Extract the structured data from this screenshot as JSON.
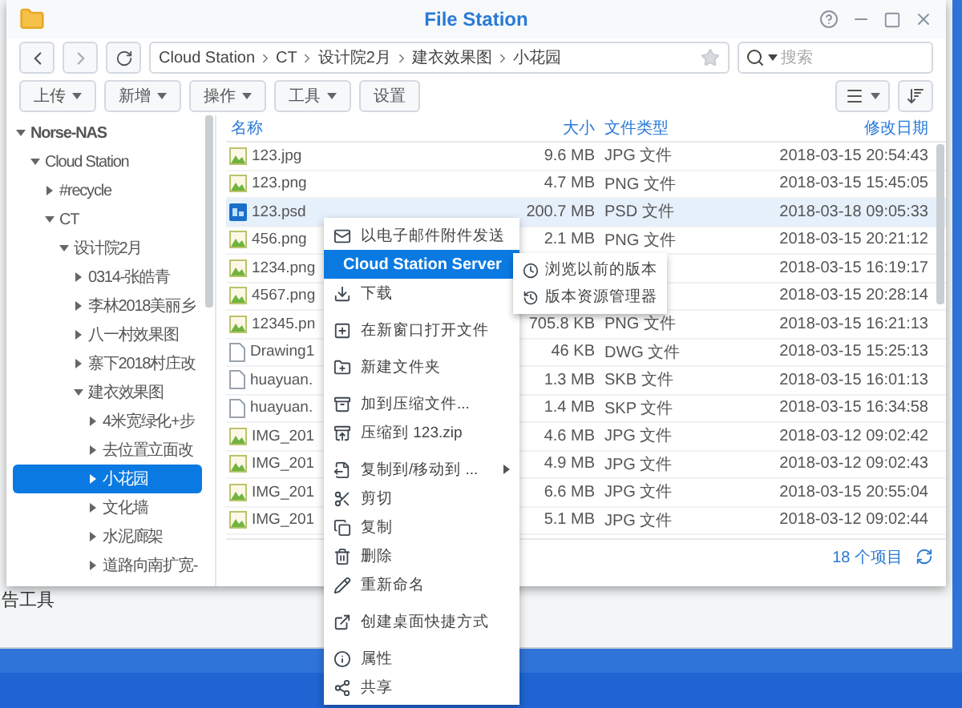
{
  "background_window": {
    "sidebar_text": "告工具"
  },
  "window": {
    "title": "File Station"
  },
  "path": {
    "segments": [
      "Cloud Station",
      "CT",
      "设计院2月",
      "建衣效果图",
      "小花园"
    ]
  },
  "search": {
    "placeholder": "搜索"
  },
  "toolbar": {
    "buttons": [
      {
        "label": "上传",
        "dropdown": true
      },
      {
        "label": "新增",
        "dropdown": true
      },
      {
        "label": "操作",
        "dropdown": true
      },
      {
        "label": "工具",
        "dropdown": true
      },
      {
        "label": "设置",
        "dropdown": false
      }
    ]
  },
  "tree": [
    {
      "label": "Norse-NAS",
      "expanded": true,
      "selected": false,
      "bold": true,
      "children": [
        {
          "label": "Cloud Station",
          "expanded": true,
          "selected": false,
          "children": [
            {
              "label": "#recycle",
              "expanded": false,
              "selected": false
            },
            {
              "label": "CT",
              "expanded": true,
              "selected": false,
              "children": [
                {
                  "label": "设计院2月",
                  "expanded": true,
                  "selected": false,
                  "children": [
                    {
                      "label": "0314-张皓青",
                      "expanded": false,
                      "selected": false
                    },
                    {
                      "label": "李林2018美丽乡",
                      "expanded": false,
                      "selected": false
                    },
                    {
                      "label": "八一村效果图",
                      "expanded": false,
                      "selected": false
                    },
                    {
                      "label": "寨下2018村庄改",
                      "expanded": false,
                      "selected": false
                    },
                    {
                      "label": "建衣效果图",
                      "expanded": true,
                      "selected": false,
                      "children": [
                        {
                          "label": "4米宽绿化+步",
                          "expanded": false,
                          "selected": false
                        },
                        {
                          "label": "去位置立面改",
                          "expanded": false,
                          "selected": false
                        },
                        {
                          "label": "小花园",
                          "expanded": false,
                          "selected": true
                        },
                        {
                          "label": "文化墙",
                          "expanded": false,
                          "selected": false
                        },
                        {
                          "label": "水泥廊架",
                          "expanded": false,
                          "selected": false
                        },
                        {
                          "label": "道路向南扩宽-",
                          "expanded": false,
                          "selected": false
                        }
                      ]
                    }
                  ]
                }
              ]
            }
          ]
        }
      ]
    }
  ],
  "table": {
    "columns": [
      "名称",
      "大小",
      "文件类型",
      "修改日期"
    ],
    "rows": [
      {
        "kind": "image",
        "name": "123.jpg",
        "size": "9.6 MB",
        "type": "JPG 文件",
        "modified": "2018-03-15 20:54:43",
        "selected": false
      },
      {
        "kind": "image",
        "name": "123.png",
        "size": "4.7 MB",
        "type": "PNG 文件",
        "modified": "2018-03-15 15:45:05",
        "selected": false
      },
      {
        "kind": "psd",
        "name": "123.psd",
        "size": "200.7 MB",
        "type": "PSD 文件",
        "modified": "2018-03-18 09:05:33",
        "selected": true
      },
      {
        "kind": "image",
        "name": "456.png",
        "size": "2.1 MB",
        "type": "PNG 文件",
        "modified": "2018-03-15 20:21:12",
        "selected": false
      },
      {
        "kind": "image",
        "name": "1234.png",
        "modified": "2018-03-15 16:19:17",
        "selected": false
      },
      {
        "kind": "image",
        "name": "4567.png",
        "modified": "2018-03-15 20:28:14",
        "selected": false
      },
      {
        "kind": "image",
        "name": "12345.pn",
        "size": "705.8 KB",
        "type": "PNG 文件",
        "modified": "2018-03-15 16:21:13",
        "selected": false
      },
      {
        "kind": "document",
        "name": "Drawing1",
        "size": "46 KB",
        "type": "DWG 文件",
        "modified": "2018-03-15 15:25:13",
        "selected": false
      },
      {
        "kind": "document",
        "name": "huayuan.",
        "size": "1.3 MB",
        "type": "SKB 文件",
        "modified": "2018-03-15 16:01:13",
        "selected": false
      },
      {
        "kind": "document",
        "name": "huayuan.",
        "size": "1.4 MB",
        "type": "SKP 文件",
        "modified": "2018-03-15 16:34:58",
        "selected": false
      },
      {
        "kind": "image",
        "name": "IMG_201",
        "size": "4.6 MB",
        "type": "JPG 文件",
        "modified": "2018-03-12 09:02:42",
        "selected": false
      },
      {
        "kind": "image",
        "name": "IMG_201",
        "size": "4.9 MB",
        "type": "JPG 文件",
        "modified": "2018-03-12 09:02:43",
        "selected": false
      },
      {
        "kind": "image",
        "name": "IMG_201",
        "size": "6.6 MB",
        "type": "JPG 文件",
        "modified": "2018-03-15 20:55:04",
        "selected": false
      },
      {
        "kind": "image",
        "name": "IMG_201",
        "size": "5.1 MB",
        "type": "JPG 文件",
        "modified": "2018-03-12 09:02:44",
        "selected": false
      }
    ]
  },
  "status_bar": {
    "count": "18 个项目"
  },
  "context_menu": {
    "items": [
      {
        "label": "以电子邮件附件发送",
        "selected": false,
        "submenu": false,
        "separator_before": false
      },
      {
        "label": "Cloud Station Server",
        "selected": true,
        "submenu": true,
        "separator_before": false
      },
      {
        "label": "下载",
        "selected": false,
        "submenu": false,
        "separator_before": false
      },
      {
        "label": "在新窗口打开文件",
        "selected": false,
        "submenu": false,
        "separator_before": true
      },
      {
        "label": "新建文件夹",
        "selected": false,
        "submenu": false,
        "separator_before": true
      },
      {
        "label": "加到压缩文件...",
        "selected": false,
        "submenu": false,
        "separator_before": true
      },
      {
        "label": "压缩到 123.zip",
        "selected": false,
        "submenu": false,
        "separator_before": false
      },
      {
        "label": "复制到/移动到 ...",
        "selected": false,
        "submenu": true,
        "separator_before": true
      },
      {
        "label": "剪切",
        "selected": false,
        "submenu": false,
        "separator_before": false
      },
      {
        "label": "复制",
        "selected": false,
        "submenu": false,
        "separator_before": false
      },
      {
        "label": "删除",
        "selected": false,
        "submenu": false,
        "separator_before": false
      },
      {
        "label": "重新命名",
        "selected": false,
        "submenu": false,
        "separator_before": false
      },
      {
        "label": "创建桌面快捷方式",
        "selected": false,
        "submenu": false,
        "separator_before": true
      },
      {
        "label": "属性",
        "selected": false,
        "submenu": false,
        "separator_before": true
      },
      {
        "label": "共享",
        "selected": false,
        "submenu": false,
        "separator_before": false
      }
    ]
  },
  "submenu": {
    "items": [
      "浏览以前的版本",
      "版本资源管理器"
    ]
  }
}
